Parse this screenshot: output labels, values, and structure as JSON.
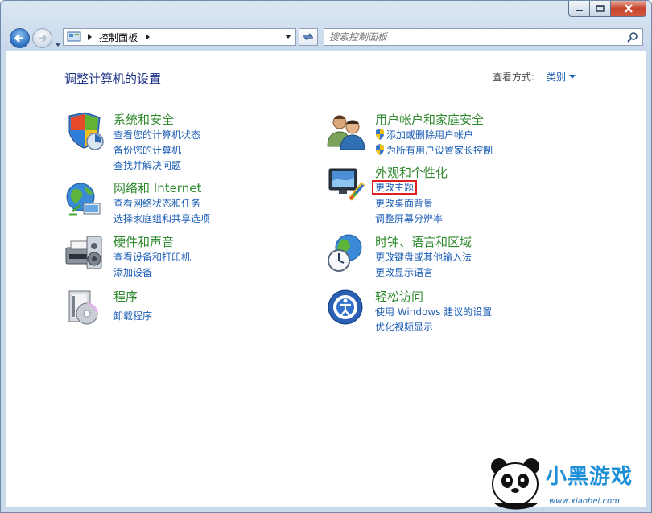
{
  "window": {
    "caption_buttons": [
      "minimize-icon",
      "maximize-icon",
      "close-icon"
    ]
  },
  "address": {
    "breadcrumb": "控制面板",
    "search_placeholder": "搜索控制面板"
  },
  "content": {
    "heading": "调整计算机的设置",
    "view_by_label": "查看方式:",
    "view_by_value": "类别"
  },
  "categories": [
    {
      "title": "系统和安全",
      "icon": "system-security-icon",
      "links": [
        "查看您的计算机状态",
        "备份您的计算机",
        "查找并解决问题"
      ]
    },
    {
      "title": "网络和 Internet",
      "icon": "network-icon",
      "links": [
        "查看网络状态和任务",
        "选择家庭组和共享选项"
      ]
    },
    {
      "title": "硬件和声音",
      "icon": "hardware-sound-icon",
      "links": [
        "查看设备和打印机",
        "添加设备"
      ]
    },
    {
      "title": "程序",
      "icon": "programs-icon",
      "links": [
        "卸载程序"
      ]
    },
    {
      "title": "用户帐户和家庭安全",
      "icon": "user-accounts-icon",
      "links": [
        "添加或删除用户帐户",
        "为所有用户设置家长控制"
      ]
    },
    {
      "title": "外观和个性化",
      "icon": "appearance-icon",
      "links": [
        "更改主题",
        "更改桌面背景",
        "调整屏幕分辨率"
      ]
    },
    {
      "title": "时钟、语言和区域",
      "icon": "clock-region-icon",
      "links": [
        "更改键盘或其他输入法",
        "更改显示语言"
      ]
    },
    {
      "title": "轻松访问",
      "icon": "ease-of-access-icon",
      "links": [
        "使用 Windows 建议的设置",
        "优化视频显示"
      ]
    }
  ],
  "watermark": {
    "text": "小黑游戏",
    "url": "www.xiaohei.com"
  },
  "colors": {
    "link": "#1e5fb6",
    "category_title": "#2f8a2e",
    "heading": "#1e3287",
    "highlight_box": "#e02020"
  }
}
